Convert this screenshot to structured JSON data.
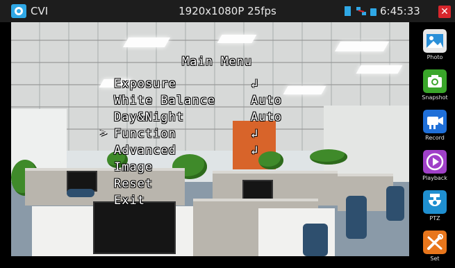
{
  "topbar": {
    "app_title": "CVI",
    "resolution": "1920x1080P 25fps",
    "clock": "6:45:33",
    "close_symbol": "✕"
  },
  "osd": {
    "title": "Main Menu",
    "items": [
      {
        "label": "Exposure",
        "value": "↲"
      },
      {
        "label": "White Balance",
        "value": "Auto"
      },
      {
        "label": "Day&Night",
        "value": "Auto"
      },
      {
        "label": "Function",
        "value": "↲"
      },
      {
        "label": "Advanced",
        "value": "↲"
      },
      {
        "label": "Image",
        "value": ""
      },
      {
        "label": "Reset",
        "value": ""
      },
      {
        "label": "Exit",
        "value": ""
      }
    ],
    "cursor": ">"
  },
  "sidebar": {
    "items": [
      {
        "label": "Photo",
        "icon": "photo-icon",
        "color": "#e8e8e8"
      },
      {
        "label": "Snapshot",
        "icon": "camera-icon",
        "color": "#3aa62a"
      },
      {
        "label": "Record",
        "icon": "video-camera-icon",
        "color": "#1f6fd8"
      },
      {
        "label": "Playback",
        "icon": "play-icon",
        "color": "#a040c8"
      },
      {
        "label": "PTZ",
        "icon": "ptz-camera-icon",
        "color": "#1f8fd0"
      },
      {
        "label": "Set",
        "icon": "tools-icon",
        "color": "#e8761c"
      }
    ]
  },
  "colors": {
    "topbar_bg": "#1d1d1d",
    "accent": "#2fa8e6",
    "close_red": "#d8262c"
  }
}
